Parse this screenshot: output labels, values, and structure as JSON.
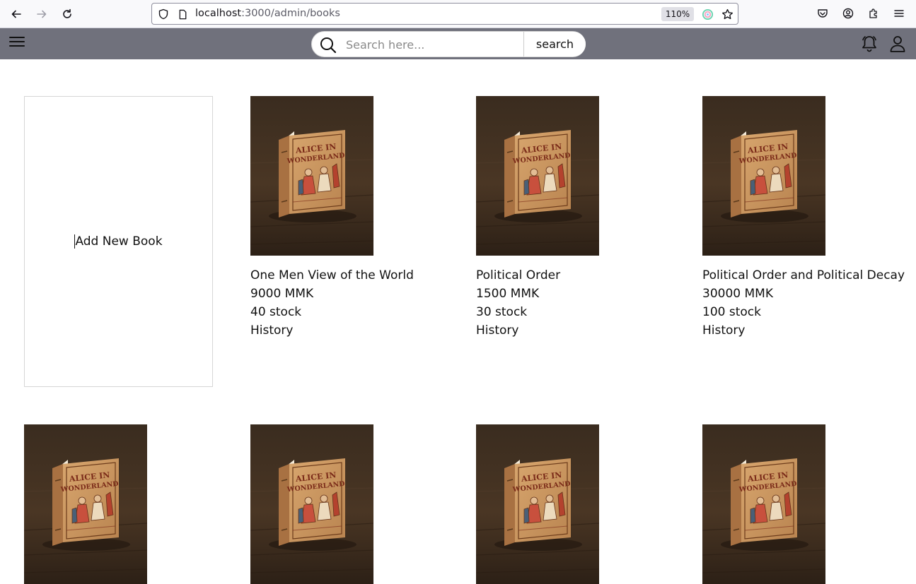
{
  "browser": {
    "url_host": "localhost",
    "url_path": ":3000/admin/books",
    "zoom": "110%"
  },
  "header": {
    "search_placeholder": "Search here...",
    "search_button": "search"
  },
  "add_card": {
    "label": "Add New Book"
  },
  "books": [
    {
      "title": "One Men View of the World",
      "price": "9000 MMK",
      "stock": "40 stock",
      "category": "History"
    },
    {
      "title": "Political Order",
      "price": "1500 MMK",
      "stock": "30 stock",
      "category": "History"
    },
    {
      "title": "Political Order and Political Decay",
      "price": "30000 MMK",
      "stock": "100 stock",
      "category": "History"
    }
  ],
  "cover": {
    "line1": "ALICE IN",
    "line2": "WONDERLAND"
  }
}
